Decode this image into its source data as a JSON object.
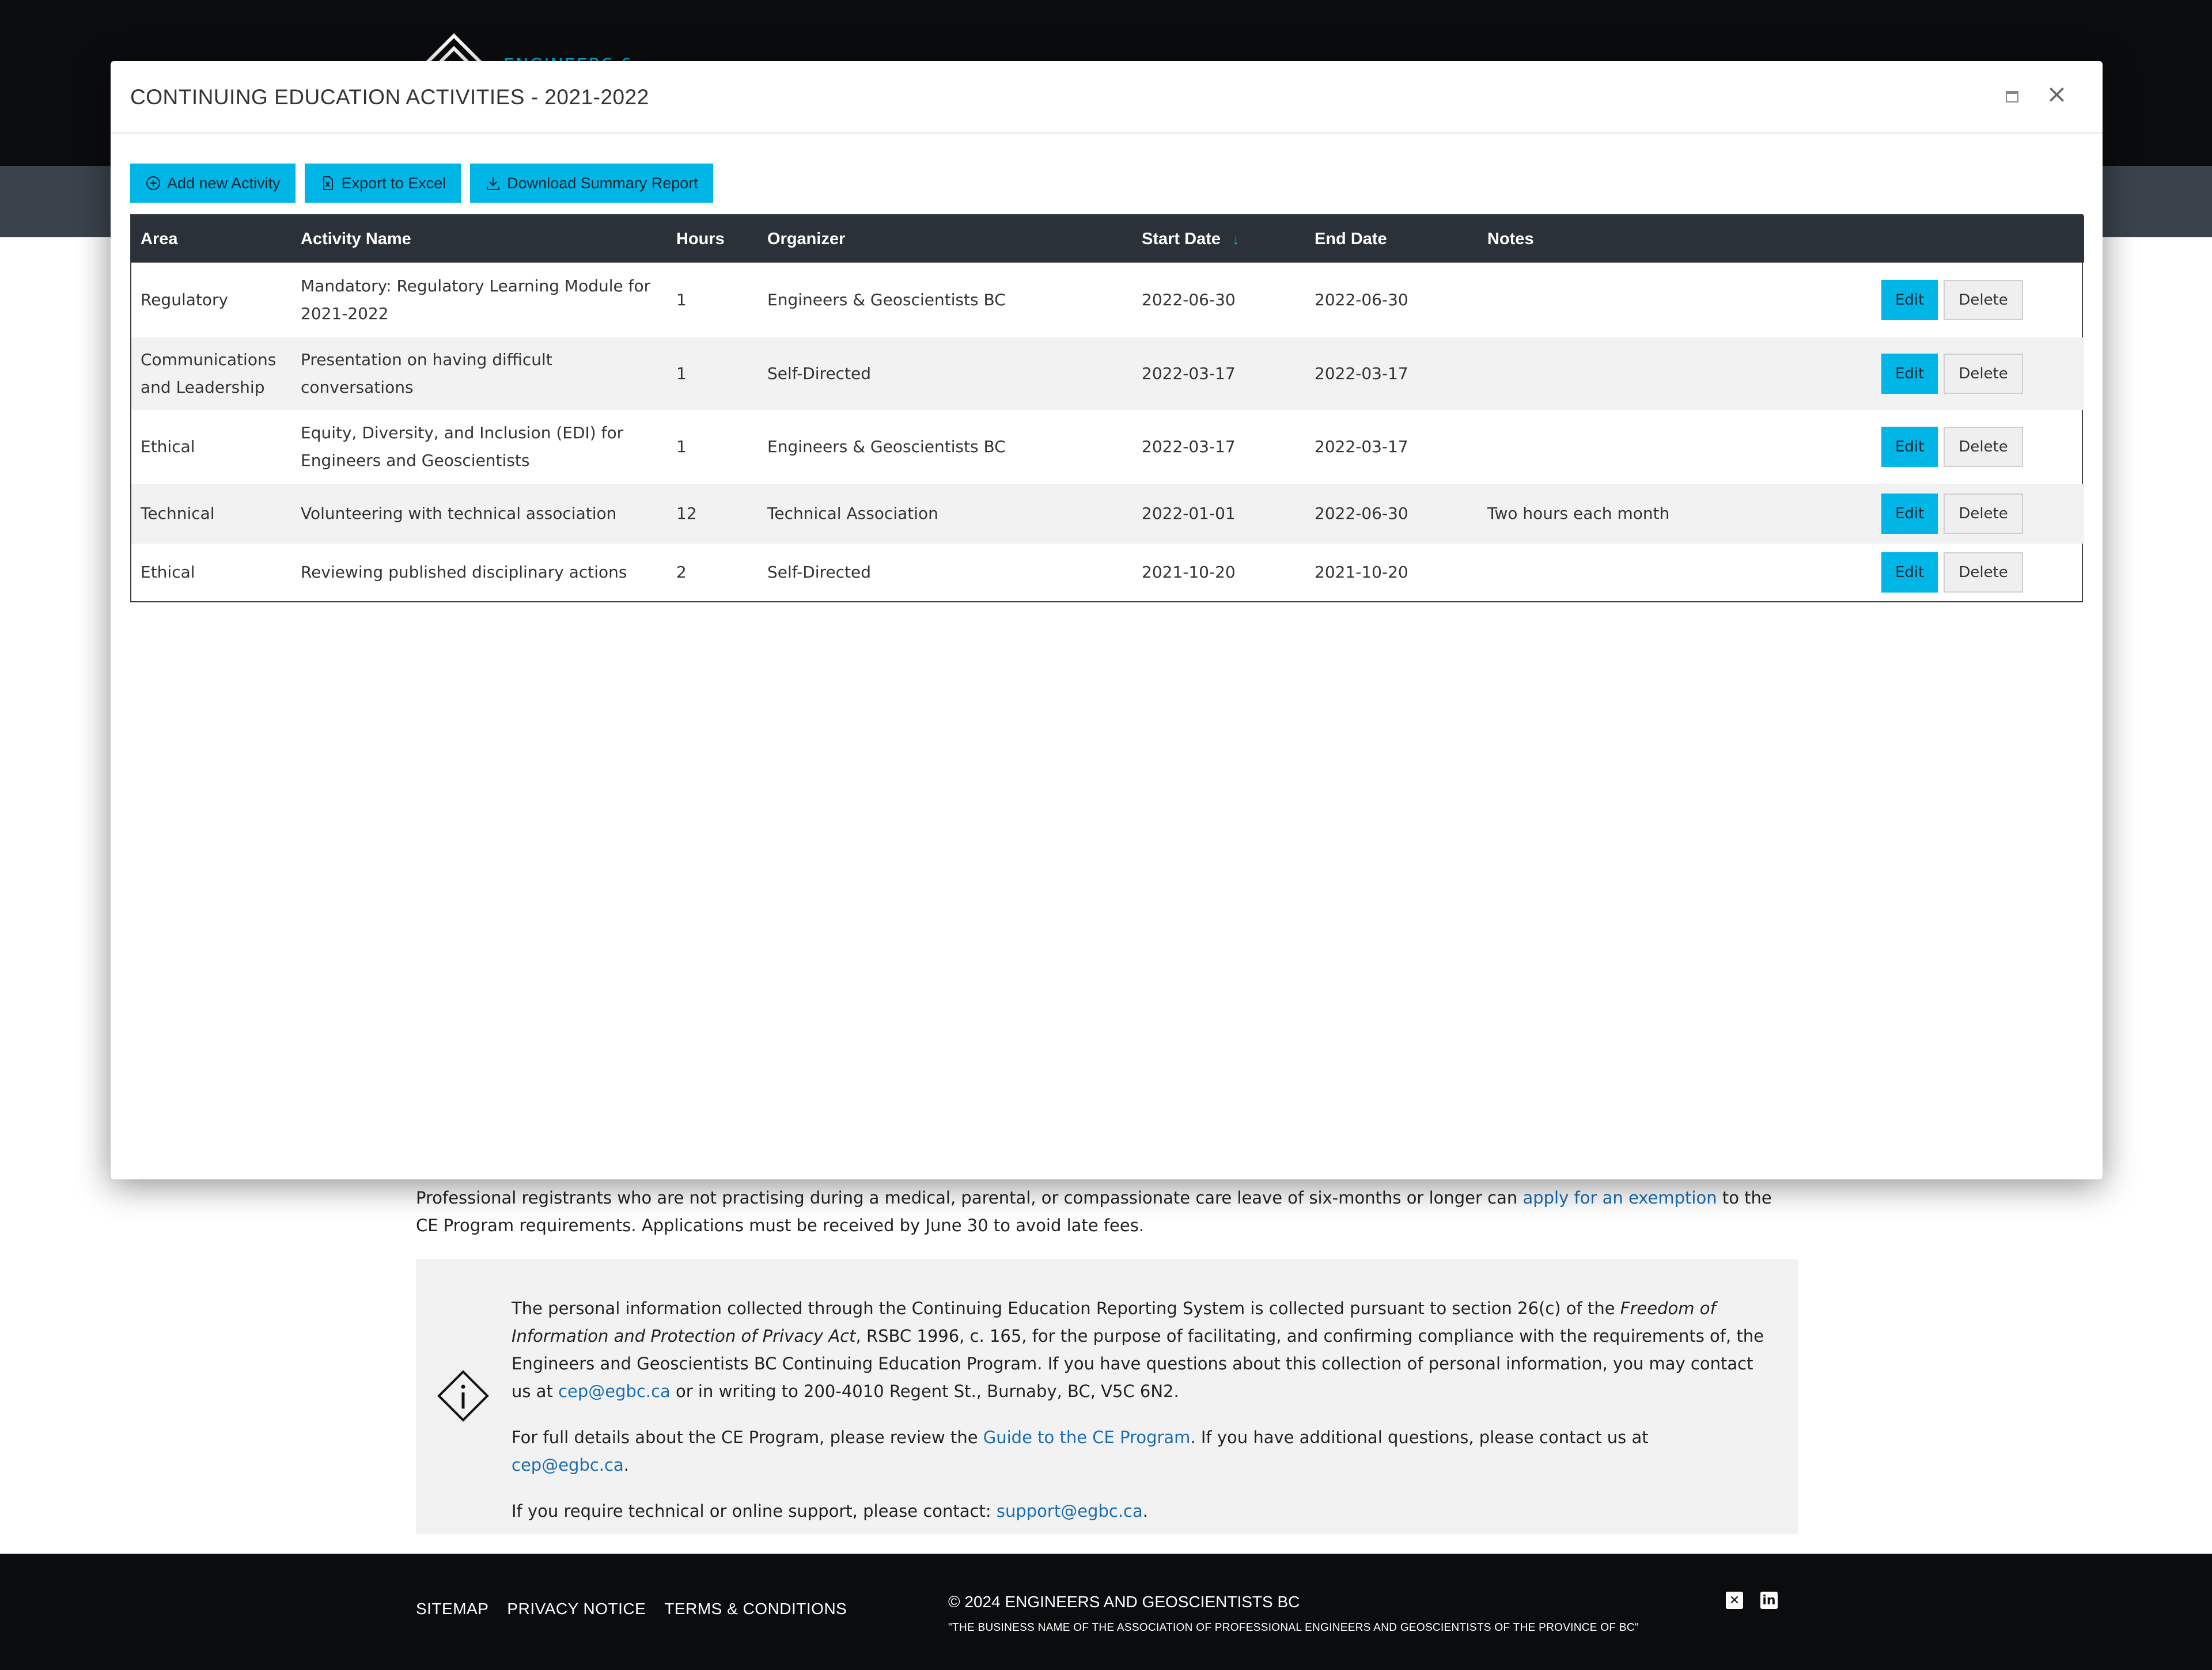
{
  "background": {
    "logo_text": "ENGINEERS &",
    "exemption": {
      "before": "Professional registrants who are not practising during a medical, parental, or compassionate care leave of six-months or longer can ",
      "link": "apply for an exemption",
      "after": " to the CE Program requirements. Applications must be received by June 30 to avoid late fees."
    },
    "info": {
      "p1_a": "The personal information collected through the Continuing Education Reporting System is collected pursuant to section 26(c) of the ",
      "p1_italic": "Freedom of Information and Protection of Privacy Act",
      "p1_b": ", RSBC 1996, c. 165, for the purpose of facilitating, and confirming compliance with the requirements of, the Engineers and Geoscientists BC Continuing Education Program. If you have questions about this collection of personal information, you may contact us at ",
      "p1_link": "cep@egbc.ca",
      "p1_c": " or in writing to 200-4010 Regent St., Burnaby, BC, V5C 6N2.",
      "p2_a": "For full details about the CE Program, please review the ",
      "p2_link1": "Guide to the CE Program",
      "p2_b": ". If you have additional questions, please contact us at ",
      "p2_link2": "cep@egbc.ca",
      "p2_c": ".",
      "p3_a": "If you require technical or online support, please contact: ",
      "p3_link": "support@egbc.ca",
      "p3_c": "."
    },
    "footer": {
      "links": [
        "SITEMAP",
        "PRIVACY NOTICE",
        "TERMS & CONDITIONS"
      ],
      "copyright": "© 2024 ENGINEERS AND GEOSCIENTISTS BC",
      "tagline": "\"THE BUSINESS NAME OF THE ASSOCIATION OF PROFESSIONAL ENGINEERS AND GEOSCIENTISTS OF THE PROVINCE OF BC\"",
      "social": [
        "x-icon",
        "linkedin-icon"
      ]
    }
  },
  "modal": {
    "title": "CONTINUING EDUCATION ACTIVITIES - 2021-2022",
    "toolbar": {
      "add": "Add new Activity",
      "export": "Export to Excel",
      "download": "Download Summary Report"
    },
    "columns": [
      "Area",
      "Activity Name",
      "Hours",
      "Organizer",
      "Start Date",
      "End Date",
      "Notes",
      ""
    ],
    "sorted_column": "Start Date",
    "rows": [
      {
        "area": "Regulatory",
        "name": "Mandatory: Regulatory Learning Module for 2021-2022",
        "hours": "1",
        "organizer": "Engineers & Geoscientists BC",
        "start": "2022-06-30",
        "end": "2022-06-30",
        "notes": ""
      },
      {
        "area": "Communications and Leadership",
        "name": "Presentation on having difficult conversations",
        "hours": "1",
        "organizer": "Self-Directed",
        "start": "2022-03-17",
        "end": "2022-03-17",
        "notes": ""
      },
      {
        "area": "Ethical",
        "name": "Equity, Diversity, and Inclusion (EDI) for Engineers and Geoscientists",
        "hours": "1",
        "organizer": "Engineers & Geoscientists BC",
        "start": "2022-03-17",
        "end": "2022-03-17",
        "notes": ""
      },
      {
        "area": "Technical",
        "name": "Volunteering with technical association",
        "hours": "12",
        "organizer": "Technical Association",
        "start": "2022-01-01",
        "end": "2022-06-30",
        "notes": "Two hours each month"
      },
      {
        "area": "Ethical",
        "name": "Reviewing published disciplinary actions",
        "hours": "2",
        "organizer": "Self-Directed",
        "start": "2021-10-20",
        "end": "2021-10-20",
        "notes": ""
      }
    ],
    "row_actions": {
      "edit": "Edit",
      "delete": "Delete"
    }
  },
  "colors": {
    "accent": "#00b6e7",
    "header_dark": "#2b3138",
    "page_dark": "#0b0c0e"
  }
}
